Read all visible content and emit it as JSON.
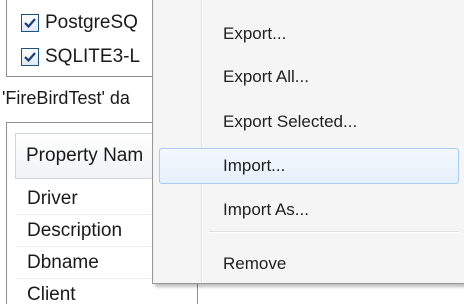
{
  "drivers": [
    {
      "label": "PostgreSQ",
      "checked": true
    },
    {
      "label": "SQLITE3-L",
      "checked": true
    }
  ],
  "status_text": "'FireBirdTest' da",
  "properties": {
    "header": "Property Nam",
    "rows": [
      "Driver",
      "Description",
      "Dbname",
      "Client"
    ]
  },
  "context_menu": {
    "items": [
      {
        "label": "Export..."
      },
      {
        "label": "Export All..."
      },
      {
        "label": "Export Selected..."
      },
      {
        "label": "Import...",
        "highlighted": true
      },
      {
        "label": "Import As..."
      },
      {
        "label": "Remove"
      }
    ]
  },
  "colors": {
    "menu_background": "#f5f5f5",
    "hover_border": "#a8cbef",
    "hover_fill": "#e6f0fa",
    "checkbox_border": "#1c5180",
    "checkmark": "#1c3f77"
  }
}
